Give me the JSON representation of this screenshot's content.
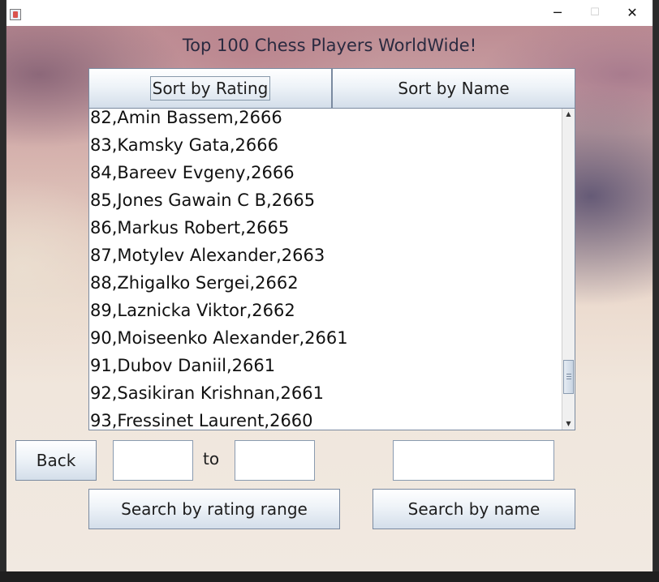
{
  "window": {
    "title": "",
    "controls": {
      "minimize": "─",
      "maximize": "☐",
      "close": "✕"
    }
  },
  "heading": "Top 100 Chess Players WorldWide!",
  "sort_buttons": {
    "rating": "Sort by Rating",
    "name": "Sort by Name"
  },
  "players": [
    "82,Amin Bassem,2666",
    "83,Kamsky Gata,2666",
    "84,Bareev Evgeny,2666",
    "85,Jones Gawain C B,2665",
    "86,Markus Robert,2665",
    "87,Motylev Alexander,2663",
    "88,Zhigalko Sergei,2662",
    "89,Laznicka Viktor,2662",
    "90,Moiseenko Alexander,2661",
    "91,Dubov Daniil,2661",
    "92,Sasikiran Krishnan,2661",
    "93,Fressinet Laurent,2660"
  ],
  "scroll": {
    "up_arrow": "▲",
    "down_arrow": "▼"
  },
  "controls": {
    "back": "Back",
    "to": "to",
    "min_rating_value": "",
    "max_rating_value": "",
    "name_value": "",
    "search_range": "Search by rating range",
    "search_name": "Search by name"
  }
}
